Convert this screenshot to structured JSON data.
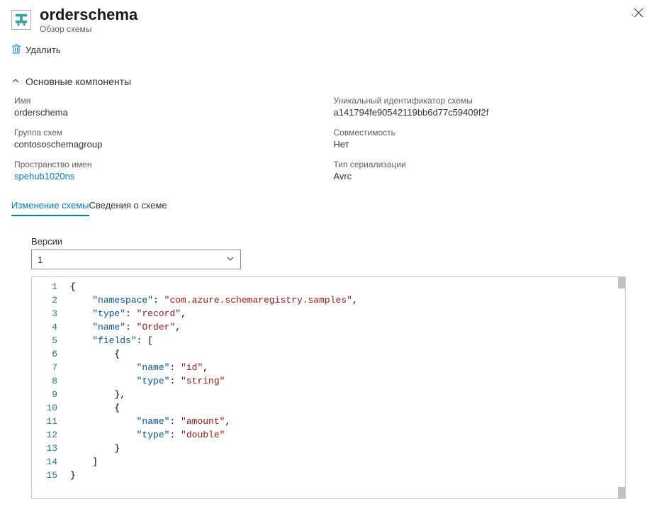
{
  "header": {
    "title": "orderschema",
    "subtitle": "Обзор схемы"
  },
  "toolbar": {
    "delete_label": "Удалить"
  },
  "essentials": {
    "header": "Основные компоненты",
    "rows": [
      {
        "left_label": "Имя",
        "left_value": "orderschema",
        "right_label": "Уникальный идентификатор схемы",
        "right_value": "a141794fe90542119bb6d77c59409f2f"
      },
      {
        "left_label": "Группа схем",
        "left_value": "contososchemagroup",
        "right_label": "Совместимость",
        "right_value": "Нет"
      },
      {
        "left_label": "Пространство имен",
        "left_value": "spehub1020ns",
        "left_is_link": true,
        "right_label": "Тип сериализации",
        "right_value": "Avrc"
      }
    ]
  },
  "tabs": {
    "items": [
      {
        "label": "Изменение схемы",
        "active": true
      },
      {
        "label": "Сведения о схеме",
        "active": false
      }
    ]
  },
  "versions": {
    "label": "Версии",
    "selected": "1"
  },
  "code": {
    "lines": [
      [
        {
          "t": "pun",
          "v": "{"
        }
      ],
      [
        {
          "t": "ind",
          "v": "    "
        },
        {
          "t": "key",
          "v": "\"namespace\""
        },
        {
          "t": "pun",
          "v": ": "
        },
        {
          "t": "str",
          "v": "\"com.azure.schemaregistry.samples\""
        },
        {
          "t": "pun",
          "v": ","
        }
      ],
      [
        {
          "t": "ind",
          "v": "    "
        },
        {
          "t": "key",
          "v": "\"type\""
        },
        {
          "t": "pun",
          "v": ": "
        },
        {
          "t": "str",
          "v": "\"record\""
        },
        {
          "t": "pun",
          "v": ","
        }
      ],
      [
        {
          "t": "ind",
          "v": "    "
        },
        {
          "t": "key",
          "v": "\"name\""
        },
        {
          "t": "pun",
          "v": ": "
        },
        {
          "t": "str",
          "v": "\"Order\""
        },
        {
          "t": "pun",
          "v": ","
        }
      ],
      [
        {
          "t": "ind",
          "v": "    "
        },
        {
          "t": "key",
          "v": "\"fields\""
        },
        {
          "t": "pun",
          "v": ": ["
        }
      ],
      [
        {
          "t": "ind",
          "v": "        "
        },
        {
          "t": "pun",
          "v": "{"
        }
      ],
      [
        {
          "t": "ind",
          "v": "            "
        },
        {
          "t": "key",
          "v": "\"name\""
        },
        {
          "t": "pun",
          "v": ": "
        },
        {
          "t": "str",
          "v": "\"id\""
        },
        {
          "t": "pun",
          "v": ","
        }
      ],
      [
        {
          "t": "ind",
          "v": "            "
        },
        {
          "t": "key",
          "v": "\"type\""
        },
        {
          "t": "pun",
          "v": ": "
        },
        {
          "t": "str",
          "v": "\"string\""
        }
      ],
      [
        {
          "t": "ind",
          "v": "        "
        },
        {
          "t": "pun",
          "v": "},"
        }
      ],
      [
        {
          "t": "ind",
          "v": "        "
        },
        {
          "t": "pun",
          "v": "{"
        }
      ],
      [
        {
          "t": "ind",
          "v": "            "
        },
        {
          "t": "key",
          "v": "\"name\""
        },
        {
          "t": "pun",
          "v": ": "
        },
        {
          "t": "str",
          "v": "\"amount\""
        },
        {
          "t": "pun",
          "v": ","
        }
      ],
      [
        {
          "t": "ind",
          "v": "            "
        },
        {
          "t": "key",
          "v": "\"type\""
        },
        {
          "t": "pun",
          "v": ": "
        },
        {
          "t": "str",
          "v": "\"double\""
        }
      ],
      [
        {
          "t": "ind",
          "v": "        "
        },
        {
          "t": "pun",
          "v": "}"
        }
      ],
      [
        {
          "t": "ind",
          "v": "    "
        },
        {
          "t": "pun",
          "v": "]"
        }
      ],
      [
        {
          "t": "pun",
          "v": "}"
        }
      ]
    ]
  }
}
